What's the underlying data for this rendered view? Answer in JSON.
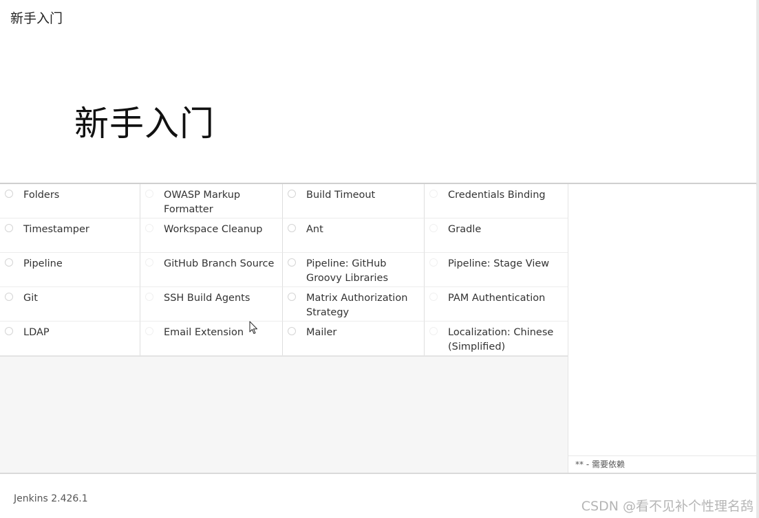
{
  "header": {
    "top_title": "新手入门",
    "hero_heading": "新手入门"
  },
  "plugins": [
    {
      "label": "Folders"
    },
    {
      "label": "OWASP Markup Formatter"
    },
    {
      "label": "Build Timeout"
    },
    {
      "label": "Credentials Binding"
    },
    {
      "label": "Timestamper"
    },
    {
      "label": "Workspace Cleanup"
    },
    {
      "label": "Ant"
    },
    {
      "label": "Gradle"
    },
    {
      "label": "Pipeline"
    },
    {
      "label": "GitHub Branch Source"
    },
    {
      "label": "Pipeline: GitHub Groovy Libraries"
    },
    {
      "label": "Pipeline: Stage View"
    },
    {
      "label": "Git"
    },
    {
      "label": "SSH Build Agents"
    },
    {
      "label": "Matrix Authorization Strategy"
    },
    {
      "label": "PAM Authentication"
    },
    {
      "label": "LDAP"
    },
    {
      "label": "Email Extension"
    },
    {
      "label": "Mailer"
    },
    {
      "label": "Localization: Chinese (Simplified)"
    }
  ],
  "side_panel": {
    "note": "** - 需要依赖"
  },
  "footer": {
    "version": "Jenkins 2.426.1",
    "watermark": "CSDN @看不见补个性理名鸹"
  },
  "icons": {
    "radio": "radio-circle-icon",
    "cursor": "mouse-pointer-icon"
  }
}
